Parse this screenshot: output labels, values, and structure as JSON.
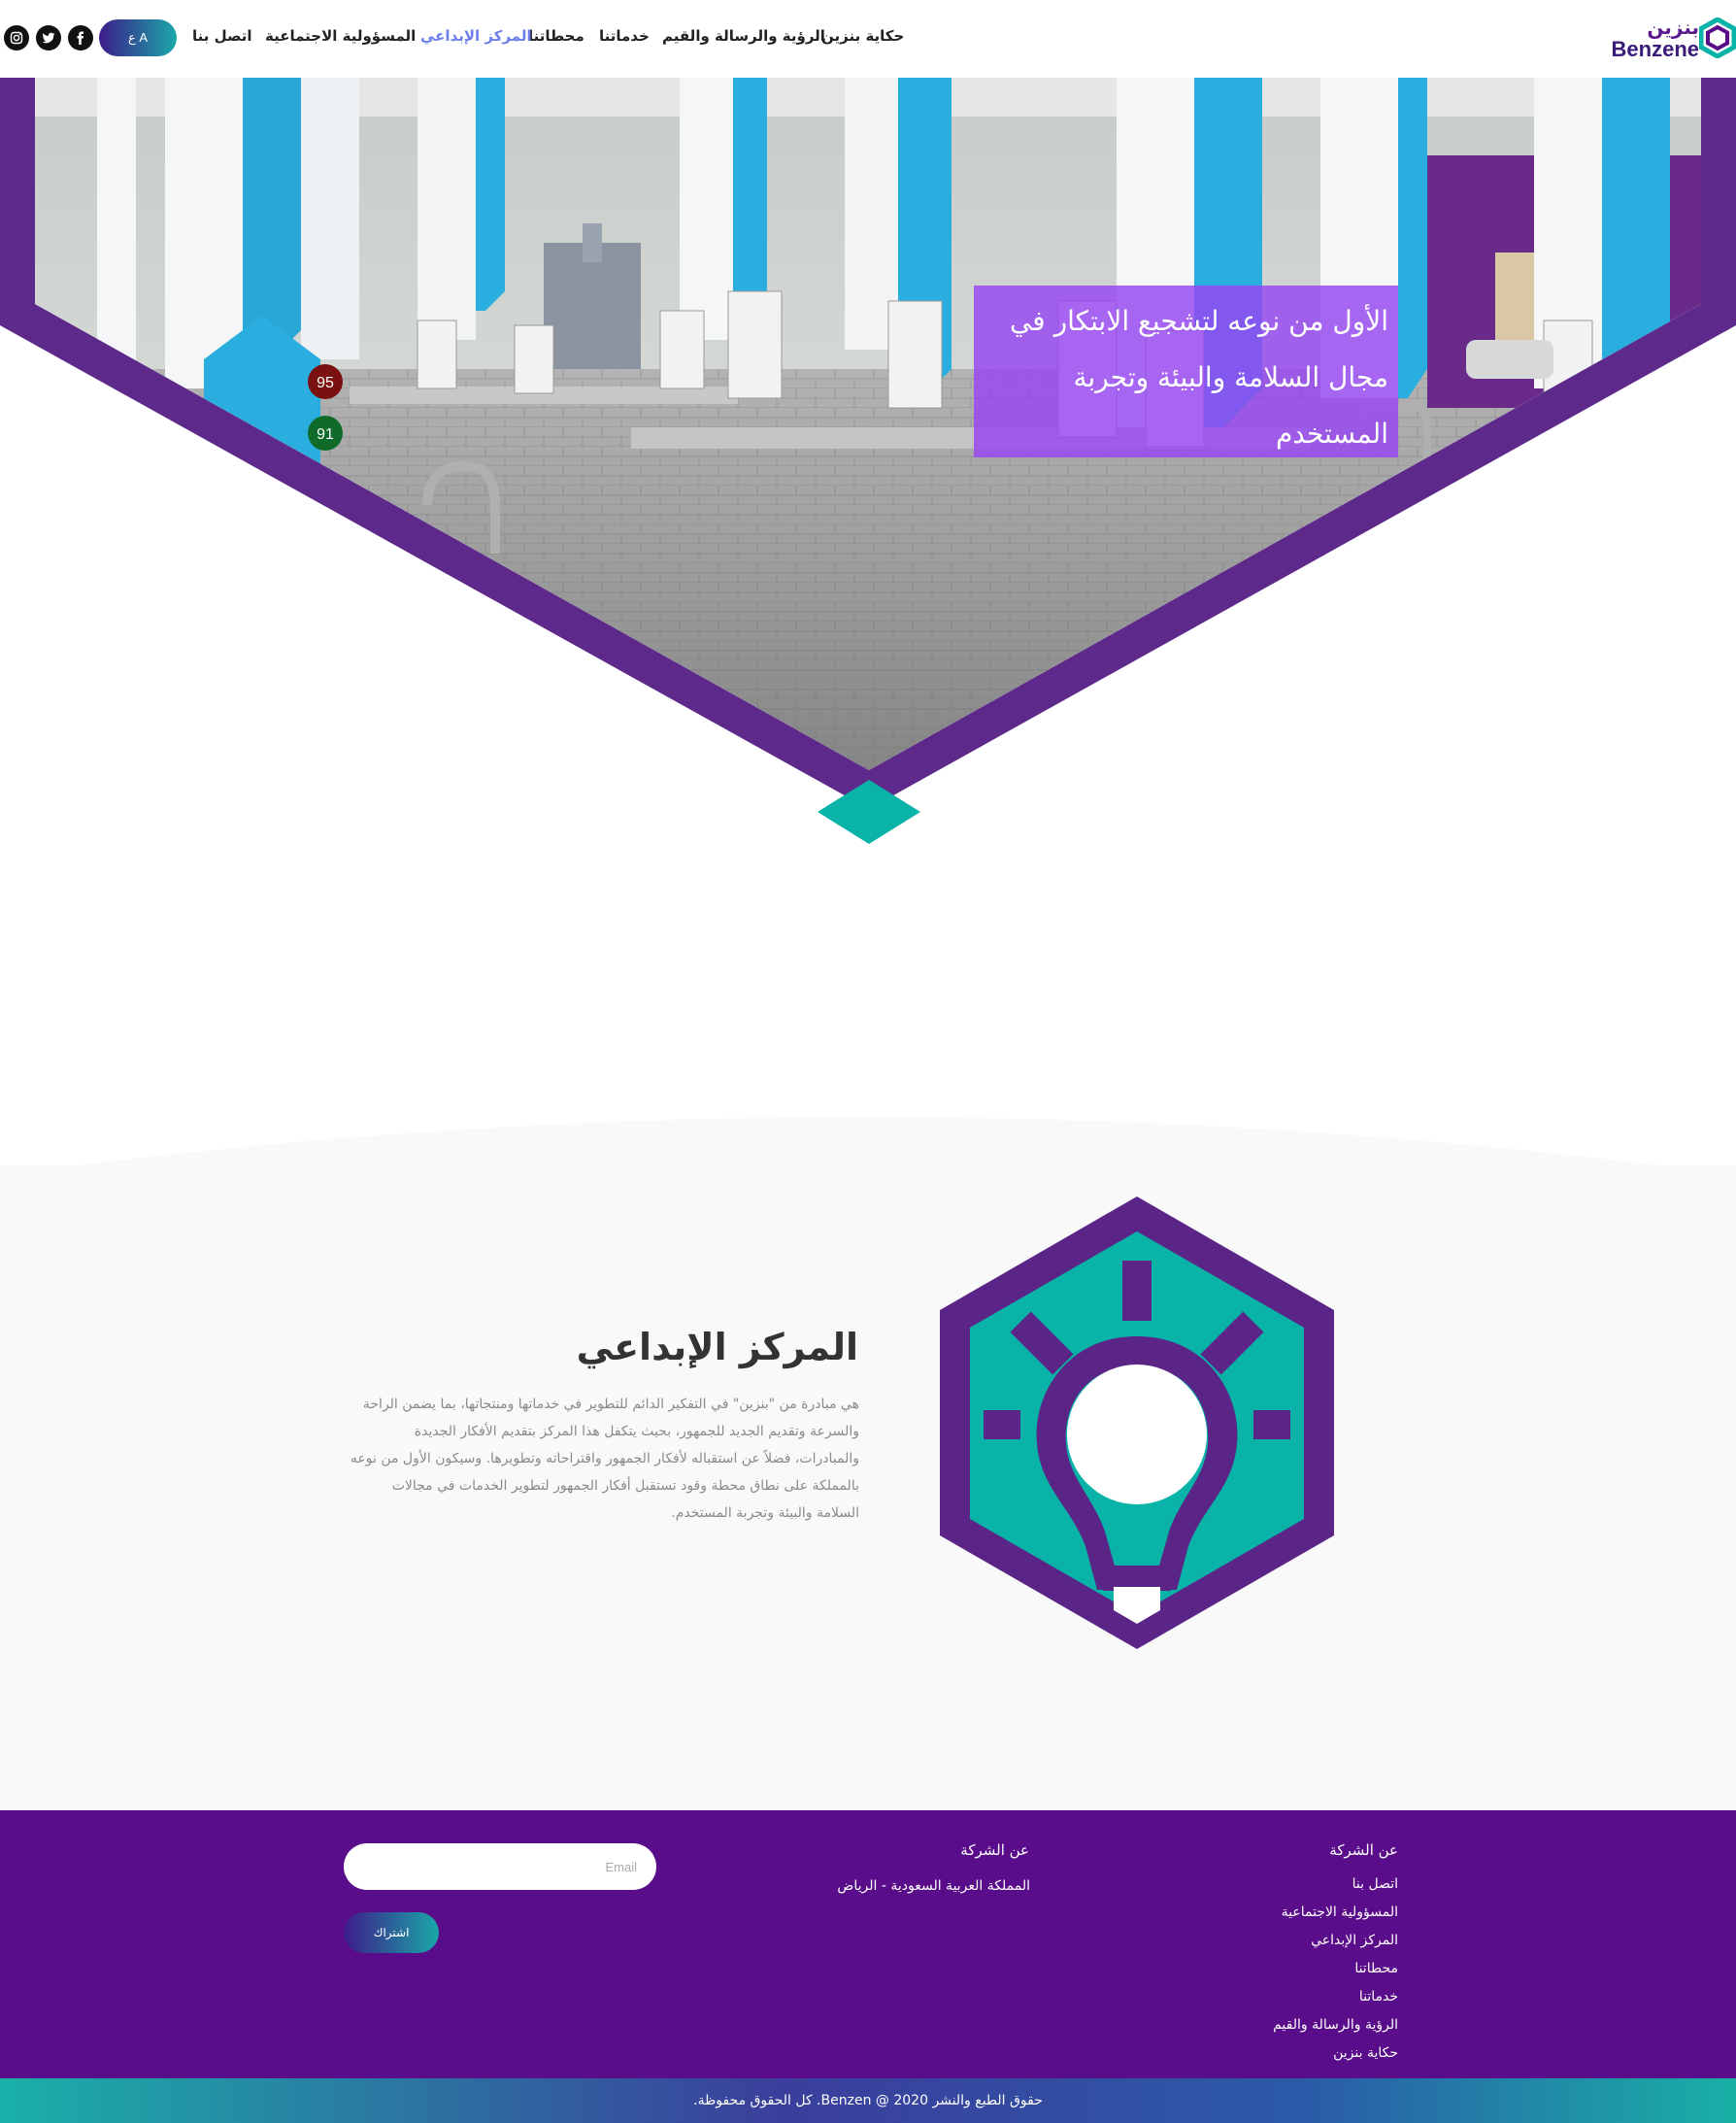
{
  "brand": {
    "logo_ar": "بنزين",
    "logo_en": "Benzene",
    "colors": {
      "purple": "#5a0d8a",
      "hero_purple": "#5d2a8c",
      "teal": "#0ab3a8",
      "hero_box": "#9646f0",
      "nav_active": "#6d7fe8"
    }
  },
  "nav": {
    "items": [
      {
        "label": "حكاية بنزين",
        "active": false
      },
      {
        "label": "الرؤية والرسالة والقيم",
        "active": false
      },
      {
        "label": "خدماتنا",
        "active": false
      },
      {
        "label": "محطاتنا",
        "active": false
      },
      {
        "label": "المركز الإبداعي",
        "active": true
      },
      {
        "label": "المسؤولية الاجتماعية",
        "active": false
      },
      {
        "label": "اتصل بنا",
        "active": false
      }
    ],
    "lang_button": "ع A",
    "social": [
      "facebook-icon",
      "twitter-icon",
      "instagram-icon"
    ]
  },
  "hero": {
    "text": "الأول من نوعه لتشجيع الابتكار في مجال السلامة والبيئة وتجربة المستخدم",
    "image_description": "benzene-fuel-station-render"
  },
  "innovation": {
    "title": "المركز الإبداعي",
    "body": "هي مبادرة من \"بنزين\" في التفكير الدائم للتطوير في خدماتها ومنتجاتها، بما يضمن الراحة والسرعة وتقديم الجديد للجمهور، بحيث يتكفل هذا المركز بتقديم الأفكار الجديدة والمبادرات، فضلاً عن استقباله لأفكار الجمهور واقتراحاته وتطويرها. وسيكون الأول من نوعه بالمملكة على نطاق محطة وقود تستقبل أفكار الجمهور لتطوير الخدمات في مجالات السلامة والبيئة وتجربة المستخدم.",
    "icon": "lightbulb-hexagon-icon"
  },
  "footer": {
    "col1_title": "عن الشركة",
    "col1_links": [
      "اتصل بنا",
      "المسؤولية الاجتماعية",
      "المركز الإبداعي",
      "محطاتنا",
      "خدماتنا",
      "الرؤية والرسالة والقيم",
      "حكاية بنزين"
    ],
    "col2_title": "عن الشركة",
    "col2_address": "المملكة العربية السعودية - الرياض",
    "email_placeholder": "Email",
    "subscribe_label": "اشتراك",
    "copyright": "حقوق الطبع والنشر 2020 @ Benzen. كل الحقوق محفوظة."
  }
}
